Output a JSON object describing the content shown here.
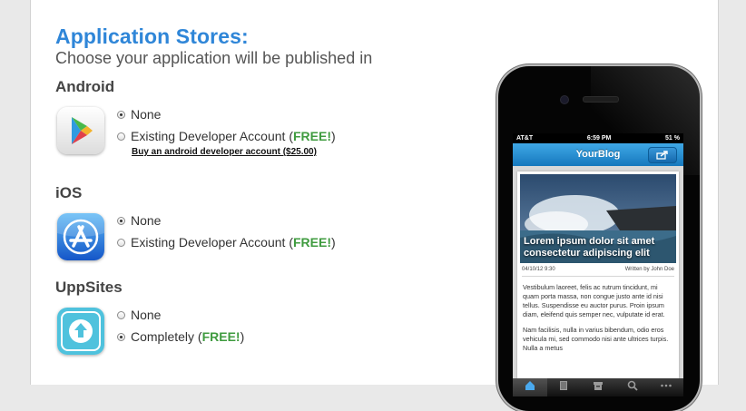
{
  "header": {
    "title": "Application Stores:",
    "subtitle": "Choose your application will be published in"
  },
  "sections": [
    {
      "title": "Android",
      "icon": "google-play-icon",
      "options": [
        {
          "label": "None",
          "selected": true
        },
        {
          "label_prefix": "Existing Developer Account (",
          "free": "FREE!",
          "label_suffix": ")",
          "selected": false
        }
      ],
      "link": "Buy an android developer account ($25.00)"
    },
    {
      "title": "iOS",
      "icon": "app-store-icon",
      "options": [
        {
          "label": "None",
          "selected": true
        },
        {
          "label_prefix": "Existing Developer Account (",
          "free": "FREE!",
          "label_suffix": ")",
          "selected": false
        }
      ]
    },
    {
      "title": "UppSites",
      "icon": "uppsites-icon",
      "options": [
        {
          "label": "None",
          "selected": false
        },
        {
          "label_prefix": "Completely (",
          "free": "FREE!",
          "label_suffix": ")",
          "selected": true
        }
      ]
    }
  ],
  "phone": {
    "status": {
      "carrier": "AT&T",
      "time": "6:59 PM",
      "battery": "51 %"
    },
    "app_name": "YourBlog",
    "article": {
      "headline": "Lorem ipsum dolor sit amet consectetur adipiscing elit",
      "date": "04/10/12 9:30",
      "author": "Written by John Doe",
      "paragraph1": "Vestibulum laoreet, felis ac rutrum tincidunt, mi quam porta massa, non congue justo ante id nisi tellus. Suspendisse eu auctor purus. Proin ipsum diam, eleifend quis semper nec, vulputate id erat.",
      "paragraph2": "Nam facilisis, nulla in varius bibendum, odio eros vehicula mi, sed commodo nisi ante ultrices turpis. Nulla a metus"
    },
    "tabs": [
      "home-icon",
      "list-icon",
      "archive-icon",
      "search-icon",
      "more-icon"
    ]
  },
  "colors": {
    "title": "#2f86d8",
    "free": "#3f9b3f",
    "app_header": "#1c80c6"
  }
}
